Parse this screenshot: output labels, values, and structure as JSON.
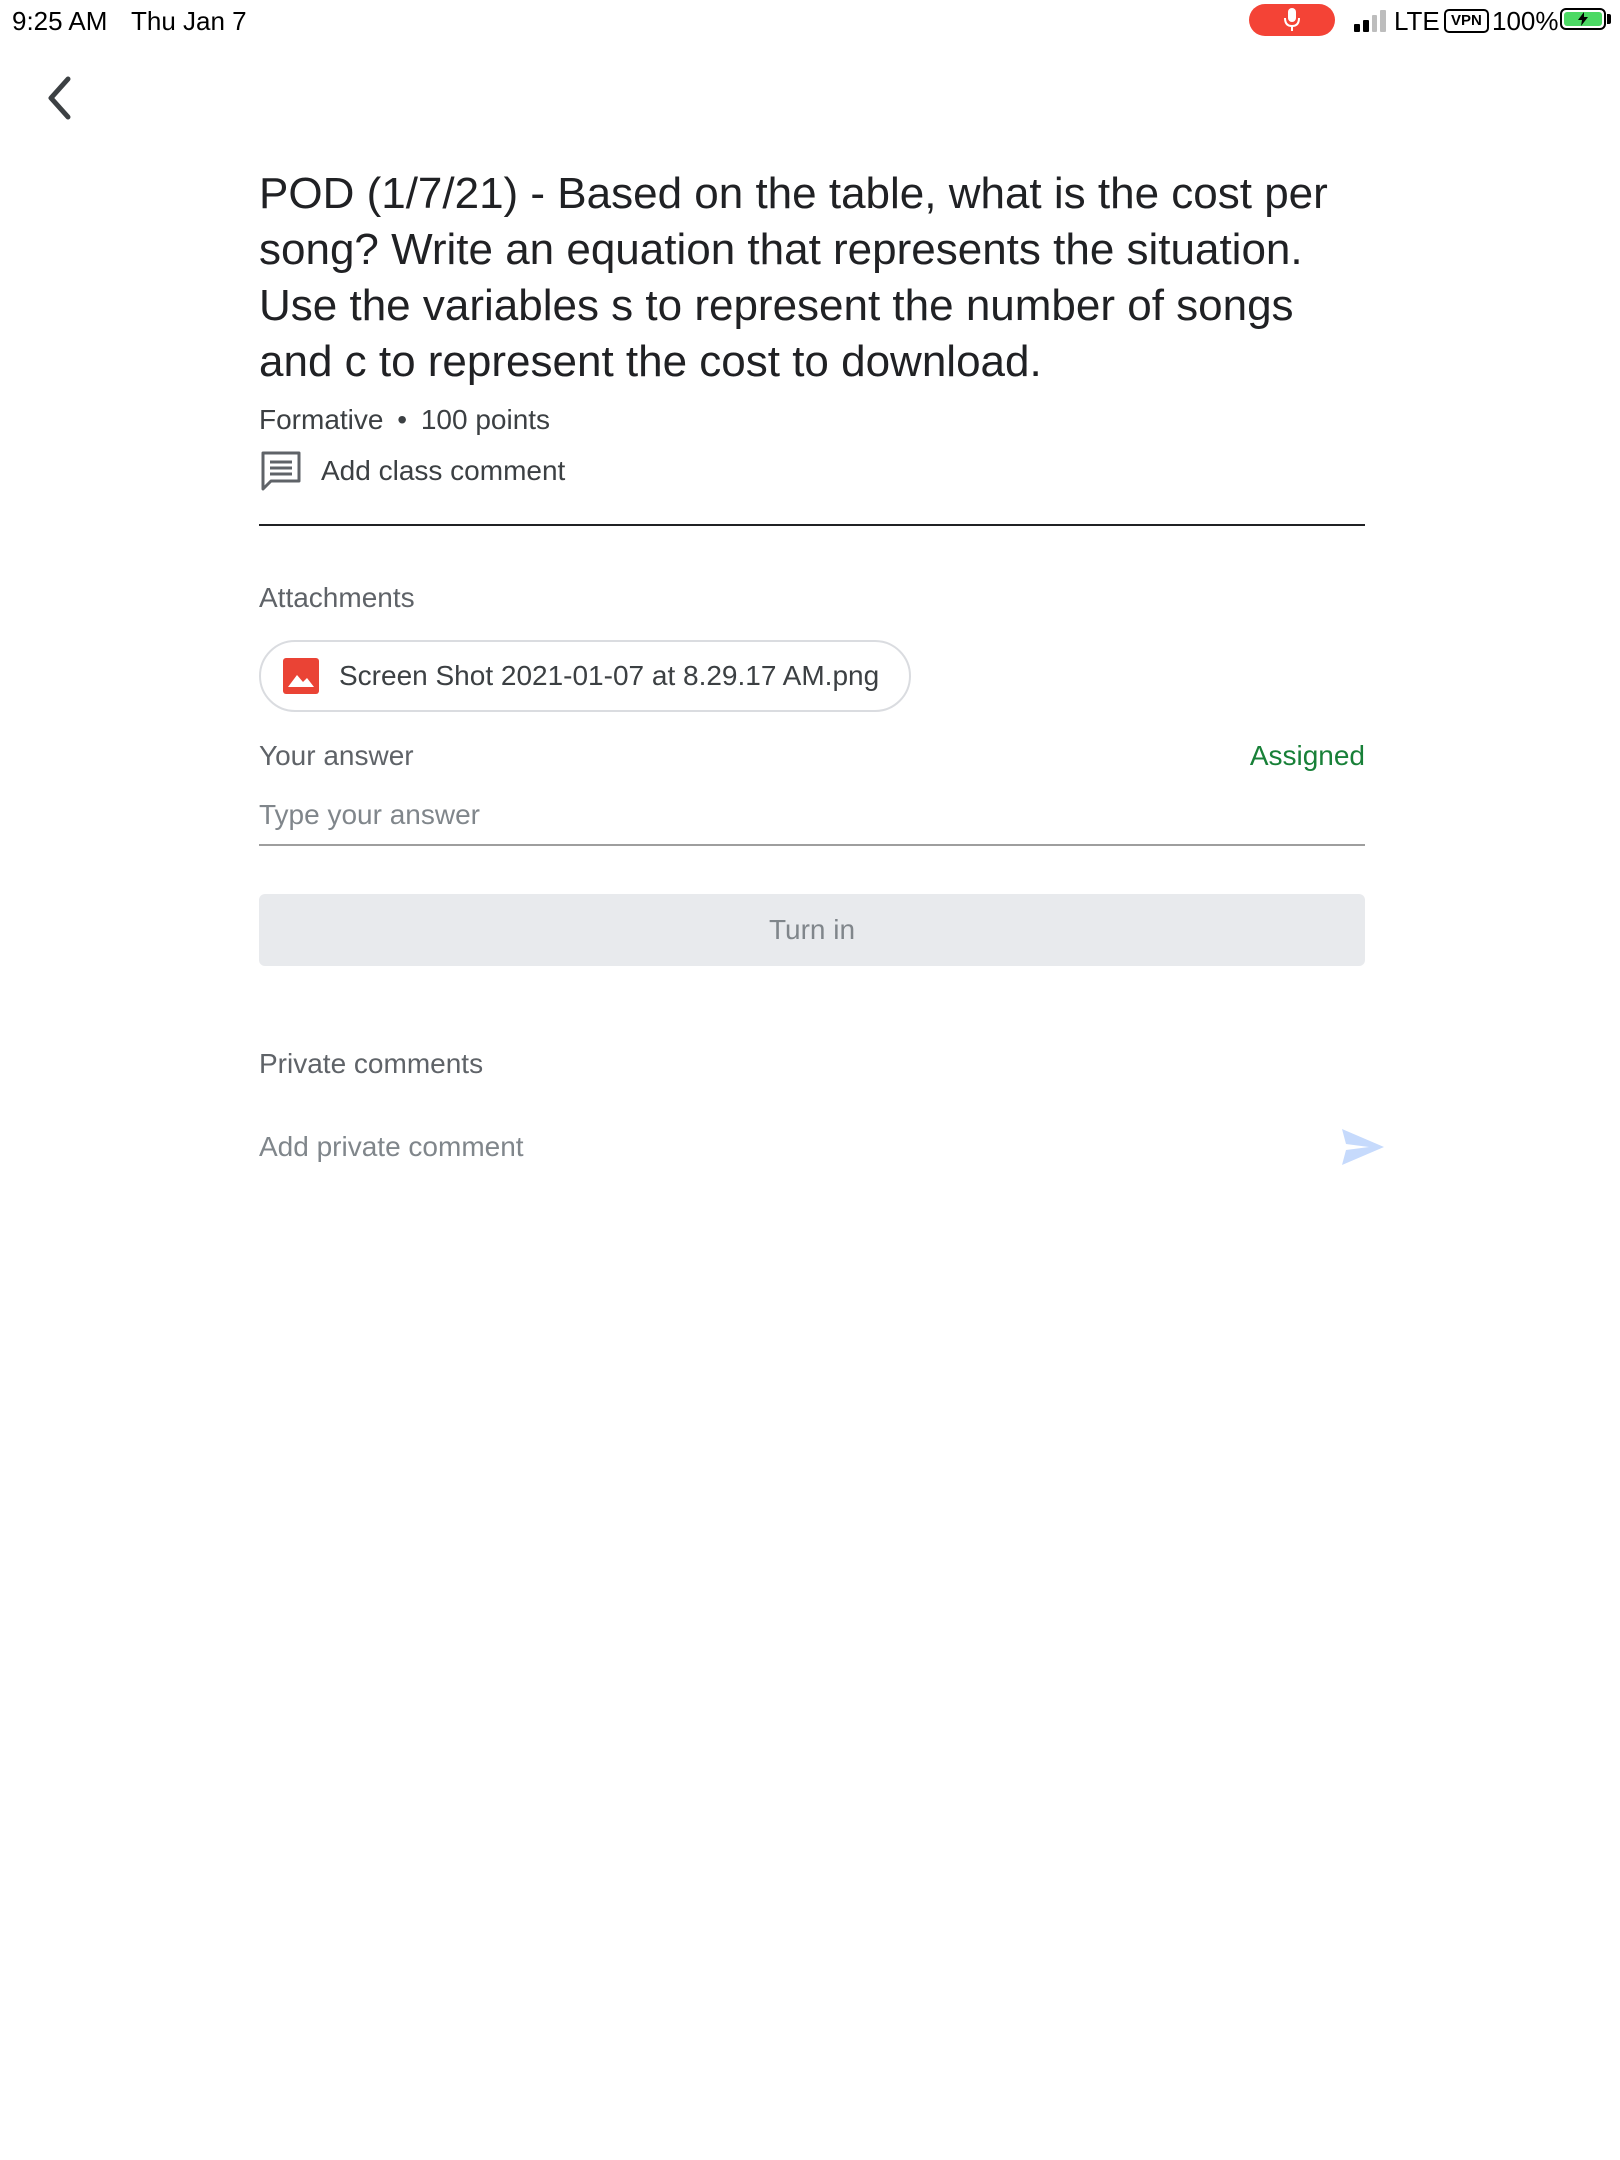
{
  "status_bar": {
    "time": "9:25 AM",
    "date": "Thu Jan 7",
    "network": "LTE",
    "vpn": "VPN",
    "battery": "100%",
    "battery_color": "#4cd964",
    "mic_color": "#f44336"
  },
  "header": {
    "back_icon": "chevron-left-icon"
  },
  "assignment": {
    "title": "POD (1/7/21) - Based on the table, what is the cost per song? Write an equation that represents the situation. Use the variables s to represent the number of songs and c to represent the cost to download.",
    "category": "Formative",
    "separator": "•",
    "points": "100 points",
    "class_comment_label": "Add class comment"
  },
  "attachments": {
    "label": "Attachments",
    "items": [
      {
        "filename": "Screen Shot 2021-01-07 at 8.29.17 AM.png",
        "icon": "image-icon",
        "icon_color": "#ea4335"
      }
    ]
  },
  "answer": {
    "label": "Your answer",
    "status": "Assigned",
    "status_color": "#188038",
    "placeholder": "Type your answer",
    "value": ""
  },
  "turn_in": {
    "label": "Turn in"
  },
  "private_comments": {
    "label": "Private comments",
    "placeholder": "Add private comment",
    "send_icon": "send-icon",
    "send_color": "#c6dafc"
  }
}
